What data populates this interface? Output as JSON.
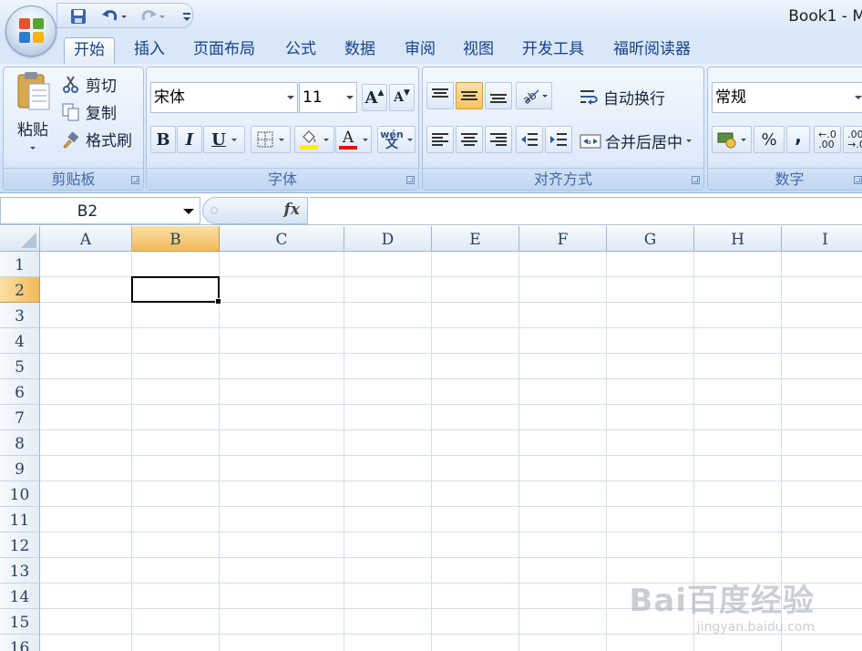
{
  "title": "Book1 - M",
  "tabs": [
    "开始",
    "插入",
    "页面布局",
    "公式",
    "数据",
    "审阅",
    "视图",
    "开发工具",
    "福昕阅读器"
  ],
  "active_tab": "开始",
  "clipboard": {
    "label": "剪贴板",
    "paste": "粘贴",
    "cut": "剪切",
    "copy": "复制",
    "format_painter": "格式刷"
  },
  "font": {
    "label": "字体",
    "name": "宋体",
    "size": "11",
    "bold": "B",
    "italic": "I",
    "underline": "U",
    "font_color_letter": "A",
    "grow": "A",
    "shrink": "A",
    "phonetic": "wén"
  },
  "alignment": {
    "label": "对齐方式",
    "wrap": "自动换行",
    "merge": "合并后居中"
  },
  "number": {
    "label": "数字",
    "format": "常规",
    "percent": "%",
    "comma": ","
  },
  "formula_bar": {
    "name_box": "B2",
    "fx": "fx",
    "value": ""
  },
  "grid": {
    "columns": [
      "A",
      "B",
      "C",
      "D",
      "E",
      "F",
      "G",
      "H",
      "I"
    ],
    "rows": [
      "1",
      "2",
      "3",
      "4",
      "5",
      "6",
      "7",
      "8",
      "9",
      "10",
      "11",
      "12",
      "13",
      "14",
      "15",
      "16"
    ],
    "selected_column": "B",
    "selected_row": "2"
  },
  "watermark": {
    "main": "Bai百度经验",
    "sub": "jingyan.baidu.com"
  },
  "colors": {
    "accent": "#15428b",
    "selection": "#f3b95b",
    "font_color_bar": "#e81010",
    "highlight_bar": "#ffee00"
  }
}
